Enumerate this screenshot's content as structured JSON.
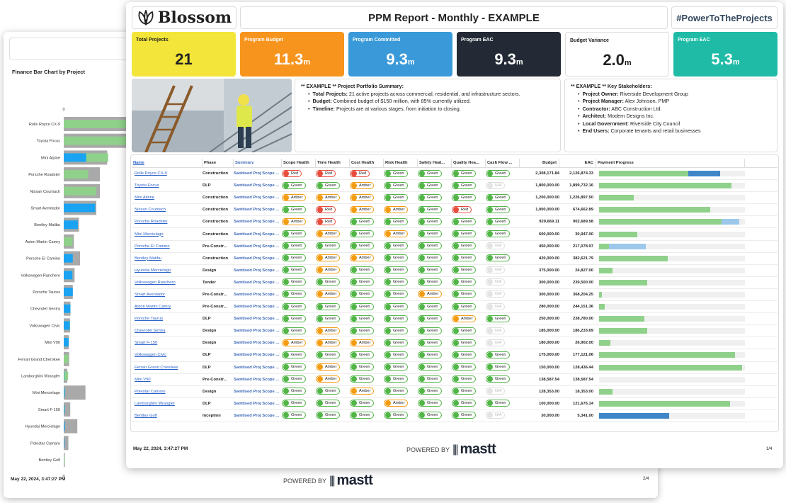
{
  "back_page": {
    "chart_title": "Finance Bar Chart by Project",
    "axis_zero_top": "0",
    "axis_zero_bottom": "0",
    "footer_date": "May 22, 2024, 3:47:27 PM",
    "powered_by": "POWERED BY",
    "brand": "mastt",
    "page": "2/4"
  },
  "chart_data": {
    "type": "bar",
    "orientation": "horizontal",
    "title": "Finance Bar Chart by Project",
    "colors": {
      "budget": "#a9a9a9",
      "committed": "#8fd18a",
      "paid": "#1aa3f2"
    },
    "categories": [
      "Rolls Royce CX-9",
      "Toyota Focus",
      "Mini Alpine",
      "Porsche Roadster",
      "Nissan Countach",
      "Smart Aventador",
      "Bentley Malibu",
      "Aston Martin Camry",
      "Porsche El Camino",
      "Volkswagen Ranchero",
      "Porsche Taurus",
      "Chevrolet Sentra",
      "Volkswagen Civic",
      "Mini V90",
      "Ferrari Grand Cherokee",
      "Lamborghini Wrangler",
      "Mini Mercielago",
      "Smart F-150",
      "Hyundai Mercielago",
      "Polestar Camaro",
      "Bentley Golf"
    ],
    "budget": [
      2308171.84,
      1800000,
      1200000,
      1000000,
      1000000,
      900000,
      420000,
      280000,
      450000,
      300000,
      250000,
      185000,
      175000,
      138587.54,
      150000,
      100000,
      600000,
      180000,
      375000,
      128353,
      30000
    ],
    "committed": [
      2126874.33,
      1899732.16,
      1226897.5,
      674662.89,
      902689.58,
      368204.25,
      382621.79,
      244151.36,
      217078.97,
      239500,
      238780,
      186233.69,
      177121.06,
      138587.54,
      128436.44,
      121676.14,
      30947,
      26902,
      24827,
      18353,
      5341
    ],
    "paid": [
      0,
      0,
      620000,
      0,
      0,
      870000,
      390000,
      0,
      250000,
      240000,
      250000,
      185000,
      168000,
      138000,
      0,
      12000,
      24000,
      21000,
      26000,
      18000,
      0
    ]
  },
  "front_page": {
    "logo_text": "Blossom",
    "report_title": "PPM Report - Monthly - EXAMPLE",
    "hashtag": "#PowerToTheProjects",
    "kpis": [
      {
        "label": "Total Projects",
        "value": "21",
        "unit": "",
        "color": "#f3e53a",
        "text": "#222"
      },
      {
        "label": "Program Budget",
        "value": "11.3",
        "unit": "m",
        "color": "#f7941d",
        "text": "#fff"
      },
      {
        "label": "Program Committed",
        "value": "9.3",
        "unit": "m",
        "color": "#3a9ad9",
        "text": "#fff"
      },
      {
        "label": "Program EAC",
        "value": "9.3",
        "unit": "m",
        "color": "#232a35",
        "text": "#fff"
      },
      {
        "label": "Budget Variance",
        "value": "2.0",
        "unit": "m",
        "color": "#ffffff",
        "text": "#222"
      },
      {
        "label": "Program EAC",
        "value": "5.3",
        "unit": "m",
        "color": "#1fbba6",
        "text": "#fff"
      }
    ],
    "summary": {
      "title": "** EXAMPLE ** Project Portfolio Summary:",
      "items": [
        {
          "k": "Total Projects:",
          "v": " 21 active projects across commercial, residential, and infrastructure sectors."
        },
        {
          "k": "Budget:",
          "v": " Combined budget of $150 million, with 85% currently utilized."
        },
        {
          "k": "Timeline:",
          "v": " Projects are at various stages, from initiation to closing."
        }
      ]
    },
    "stakeholders": {
      "title": "** EXAMPLE ** Key Stakeholders:",
      "items": [
        {
          "k": "Project Owner:",
          "v": " Riverside Development Group"
        },
        {
          "k": "Project Manager:",
          "v": " Alex Johnson, PMP"
        },
        {
          "k": "Contractor:",
          "v": " ABC Construction Ltd."
        },
        {
          "k": "Architect:",
          "v": " Modern Designs Inc."
        },
        {
          "k": "Local Government:",
          "v": " Riverside City Council"
        },
        {
          "k": "End Users:",
          "v": " Corporate tenants and retail businesses"
        }
      ]
    },
    "table_headers": [
      "Name",
      "Phase",
      "Summary",
      "Scope Health",
      "Time Health",
      "Cost Health",
      "Risk Health",
      "Safety Heal...",
      "Quality Hea...",
      "Cash Flow ...",
      "Budget",
      "EAC",
      "Payment Progress"
    ],
    "rows": [
      {
        "name": "Rolls Royce CX-9",
        "phase": "Construction",
        "summary": "Sanitised Proj Scope ...",
        "h": [
          "Red",
          "Red",
          "Red",
          "Green",
          "Green",
          "Green",
          "Green"
        ],
        "budget": "2,308,171.84",
        "eac": "2,126,874.33",
        "p1": 0.61,
        "p2": 0.22
      },
      {
        "name": "Toyota Focus",
        "phase": "DLP",
        "summary": "Sanitised Proj Scope ...",
        "h": [
          "Green",
          "Green",
          "Amber",
          "Green",
          "Green",
          "Green",
          "N/A"
        ],
        "budget": "1,800,000.00",
        "eac": "1,899,732.16",
        "p1": 0.91,
        "p2": 0
      },
      {
        "name": "Mini Alpine",
        "phase": "Construction",
        "summary": "Sanitised Proj Scope ...",
        "h": [
          "Amber",
          "Amber",
          "Amber",
          "Green",
          "Green",
          "Green",
          "Green"
        ],
        "budget": "1,200,000.00",
        "eac": "1,226,897.50",
        "p1": 0.24,
        "p2": 0
      },
      {
        "name": "Nissan Countach",
        "phase": "Construction",
        "summary": "Sanitised Proj Scope ...",
        "h": [
          "Green",
          "Red",
          "Amber",
          "Amber",
          "Green",
          "Red",
          "Green"
        ],
        "budget": "1,000,000.00",
        "eac": "674,662.89",
        "p1": 0.76,
        "p2": 0
      },
      {
        "name": "Porsche Roadster",
        "phase": "Construction",
        "summary": "Sanitised Proj Scope ...",
        "h": [
          "Amber",
          "Red",
          "Green",
          "Green",
          "Green",
          "Green",
          "Green"
        ],
        "budget": "929,669.11",
        "eac": "902,689.58",
        "p1": 0.84,
        "p2": 0.12
      },
      {
        "name": "Mini Mercielago",
        "phase": "Construction",
        "summary": "Sanitised Proj Scope ...",
        "h": [
          "Green",
          "Amber",
          "Green",
          "Amber",
          "Green",
          "Green",
          "Green"
        ],
        "budget": "600,000.00",
        "eac": "30,947.00",
        "p1": 0.26,
        "p2": 0
      },
      {
        "name": "Porsche El Camino",
        "phase": "Pre-Constr...",
        "summary": "Sanitised Proj Scope ...",
        "h": [
          "Green",
          "Green",
          "Green",
          "Green",
          "Green",
          "Green",
          "N/A"
        ],
        "budget": "450,000.00",
        "eac": "217,078.97",
        "p1": 0.07,
        "p2": 0.25
      },
      {
        "name": "Bentley Malibu",
        "phase": "Construction",
        "summary": "Sanitised Proj Scope ...",
        "h": [
          "Green",
          "Amber",
          "Amber",
          "Green",
          "Green",
          "Green",
          "Green"
        ],
        "budget": "420,000.00",
        "eac": "382,621.79",
        "p1": 0.47,
        "p2": 0
      },
      {
        "name": "Hyundai Mercielago",
        "phase": "Design",
        "summary": "Sanitised Proj Scope ...",
        "h": [
          "Green",
          "Amber",
          "Green",
          "Green",
          "Green",
          "Green",
          "N/A"
        ],
        "budget": "375,000.00",
        "eac": "24,827.00",
        "p1": 0.09,
        "p2": 0
      },
      {
        "name": "Volkswagen Ranchero",
        "phase": "Tender",
        "summary": "Sanitised Proj Scope ...",
        "h": [
          "Green",
          "Green",
          "Green",
          "Green",
          "Green",
          "Green",
          "N/A"
        ],
        "budget": "300,000.00",
        "eac": "239,500.00",
        "p1": 0.33,
        "p2": 0
      },
      {
        "name": "Smart Aventador",
        "phase": "Pre-Constr...",
        "summary": "Sanitised Proj Scope ...",
        "h": [
          "Green",
          "Amber",
          "Green",
          "Green",
          "Amber",
          "Green",
          "N/A"
        ],
        "budget": "300,000.00",
        "eac": "368,204.25",
        "p1": 0.02,
        "p2": 0
      },
      {
        "name": "Aston Martin Camry",
        "phase": "Pre-Constr...",
        "summary": "Sanitised Proj Scope ...",
        "h": [
          "Green",
          "Green",
          "Green",
          "Green",
          "Green",
          "Green",
          "N/A"
        ],
        "budget": "280,000.00",
        "eac": "244,151.36",
        "p1": 0.04,
        "p2": 0
      },
      {
        "name": "Porsche Taurus",
        "phase": "DLP",
        "summary": "Sanitised Proj Scope ...",
        "h": [
          "Green",
          "Green",
          "Green",
          "Green",
          "Green",
          "Amber",
          "Green"
        ],
        "budget": "250,000.00",
        "eac": "238,780.00",
        "p1": 0.31,
        "p2": 0
      },
      {
        "name": "Chevrolet Sentra",
        "phase": "Design",
        "summary": "Sanitised Proj Scope ...",
        "h": [
          "Green",
          "Amber",
          "Green",
          "Green",
          "Green",
          "Green",
          "N/A"
        ],
        "budget": "185,000.00",
        "eac": "186,233.69",
        "p1": 0.33,
        "p2": 0
      },
      {
        "name": "Smart F-150",
        "phase": "Design",
        "summary": "Sanitised Proj Scope ...",
        "h": [
          "Amber",
          "Amber",
          "Amber",
          "Green",
          "Green",
          "Green",
          "N/A"
        ],
        "budget": "180,000.00",
        "eac": "26,902.00",
        "p1": 0.08,
        "p2": 0
      },
      {
        "name": "Volkswagen Civic",
        "phase": "DLP",
        "summary": "Sanitised Proj Scope ...",
        "h": [
          "Green",
          "Green",
          "Green",
          "Green",
          "Green",
          "Green",
          "Green"
        ],
        "budget": "175,000.00",
        "eac": "177,121.06",
        "p1": 0.93,
        "p2": 0
      },
      {
        "name": "Ferrari Grand Cherokee",
        "phase": "DLP",
        "summary": "Sanitised Proj Scope ...",
        "h": [
          "Green",
          "Amber",
          "Green",
          "Green",
          "Green",
          "Green",
          "Green"
        ],
        "budget": "150,000.00",
        "eac": "128,436.44",
        "p1": 0.98,
        "p2": 0
      },
      {
        "name": "Mini V90",
        "phase": "Pre-Constr...",
        "summary": "Sanitised Proj Scope ...",
        "h": [
          "Green",
          "Amber",
          "Green",
          "Green",
          "Green",
          "Green",
          "Green"
        ],
        "budget": "138,587.54",
        "eac": "138,587.54",
        "p1": 0,
        "p2": 0
      },
      {
        "name": "Polestar Camaro",
        "phase": "Design",
        "summary": "Sanitised Proj Scope ...",
        "h": [
          "Green",
          "Green",
          "Amber",
          "Green",
          "Green",
          "Green",
          "N/A"
        ],
        "budget": "128,353.00",
        "eac": "18,353.00",
        "p1": 0.09,
        "p2": 0
      },
      {
        "name": "Lamborghini Wrangler",
        "phase": "DLP",
        "summary": "Sanitised Proj Scope ...",
        "h": [
          "Green",
          "Green",
          "Green",
          "Amber",
          "Green",
          "Green",
          "Green"
        ],
        "budget": "100,000.00",
        "eac": "121,676.14",
        "p1": 0.9,
        "p2": 0
      },
      {
        "name": "Bentley Golf",
        "phase": "Inception",
        "summary": "Sanitised Proj Scope ...",
        "h": [
          "Green",
          "Green",
          "Green",
          "Green",
          "Green",
          "Green",
          "N/A"
        ],
        "budget": "30,000.00",
        "eac": "5,341.00",
        "p1": 0,
        "p2": 0.48
      }
    ],
    "footer_date": "May 22, 2024, 3:47:27 PM",
    "powered_by": "POWERED BY",
    "brand": "mastt",
    "page": "1/4",
    "bar_colors": {
      "paid": "#8fd18a",
      "other": "#3f86c9",
      "light": "#9cc8ec"
    }
  }
}
